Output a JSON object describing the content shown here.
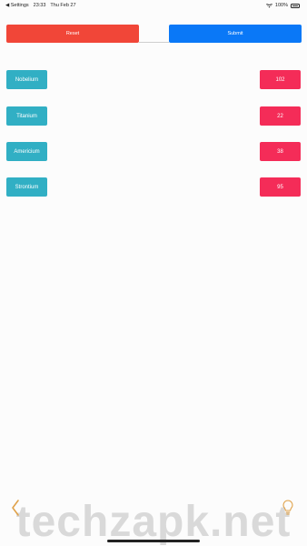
{
  "status_bar": {
    "back_app": "◀ Settings",
    "time": "23:33",
    "date": "Thu Feb 27",
    "battery": "100%"
  },
  "actions": {
    "reset_label": "Reset",
    "submit_label": "Submit"
  },
  "rows": [
    {
      "element": "Nobelium",
      "value": "102"
    },
    {
      "element": "Titanium",
      "value": "22"
    },
    {
      "element": "Americium",
      "value": "38"
    },
    {
      "element": "Strontium",
      "value": "95"
    }
  ],
  "watermark": "techzapk.net",
  "icons": {
    "back": "chevron-left-icon",
    "hint": "lightbulb-icon"
  },
  "colors": {
    "reset": "#f14638",
    "submit": "#0a78f7",
    "element": "#31afc4",
    "value": "#f42c58",
    "icon_accent": "#e0a24a"
  }
}
